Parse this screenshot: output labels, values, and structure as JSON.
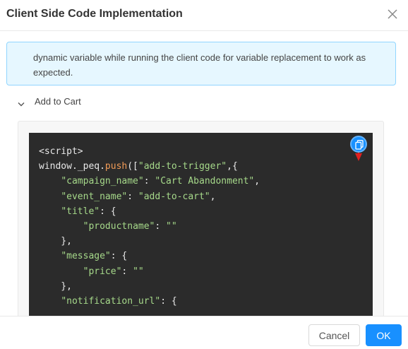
{
  "dialog": {
    "title": "Client Side Code Implementation",
    "close_icon": "close-icon"
  },
  "info": {
    "text": "dynamic variable while running the client code for variable replacement to work as expected."
  },
  "section": {
    "label": "Add to Cart",
    "expanded": true,
    "chevron_icon": "chevron-down-icon"
  },
  "code": {
    "lines": [
      [
        {
          "t": "<script>",
          "c": ""
        }
      ],
      [
        {
          "t": "window._peq.",
          "c": ""
        },
        {
          "t": "push",
          "c": "fn"
        },
        {
          "t": "([",
          "c": ""
        },
        {
          "t": "\"add-to-trigger\"",
          "c": "str"
        },
        {
          "t": ",{",
          "c": ""
        }
      ],
      [
        {
          "t": "    ",
          "c": ""
        },
        {
          "t": "\"campaign_name\"",
          "c": "str"
        },
        {
          "t": ": ",
          "c": ""
        },
        {
          "t": "\"Cart Abandonment\"",
          "c": "str"
        },
        {
          "t": ",",
          "c": ""
        }
      ],
      [
        {
          "t": "    ",
          "c": ""
        },
        {
          "t": "\"event_name\"",
          "c": "str"
        },
        {
          "t": ": ",
          "c": ""
        },
        {
          "t": "\"add-to-cart\"",
          "c": "str"
        },
        {
          "t": ",",
          "c": ""
        }
      ],
      [
        {
          "t": "    ",
          "c": ""
        },
        {
          "t": "\"title\"",
          "c": "str"
        },
        {
          "t": ": {",
          "c": ""
        }
      ],
      [
        {
          "t": "        ",
          "c": ""
        },
        {
          "t": "\"productname\"",
          "c": "str"
        },
        {
          "t": ": ",
          "c": ""
        },
        {
          "t": "\"\"",
          "c": "str"
        }
      ],
      [
        {
          "t": "    },",
          "c": ""
        }
      ],
      [
        {
          "t": "    ",
          "c": ""
        },
        {
          "t": "\"message\"",
          "c": "str"
        },
        {
          "t": ": {",
          "c": ""
        }
      ],
      [
        {
          "t": "        ",
          "c": ""
        },
        {
          "t": "\"price\"",
          "c": "str"
        },
        {
          "t": ": ",
          "c": ""
        },
        {
          "t": "\"\"",
          "c": "str"
        }
      ],
      [
        {
          "t": "    },",
          "c": ""
        }
      ],
      [
        {
          "t": "    ",
          "c": ""
        },
        {
          "t": "\"notification_url\"",
          "c": "str"
        },
        {
          "t": ": {",
          "c": ""
        }
      ]
    ],
    "copy_icon": "copy-icon",
    "annotation_arrow_color": "#e02020"
  },
  "colors": {
    "primary": "#1890ff",
    "code_bg": "#2b2b2b",
    "code_string": "#a6d98a",
    "code_function": "#f39c57"
  },
  "footer": {
    "cancel_label": "Cancel",
    "ok_label": "OK"
  }
}
